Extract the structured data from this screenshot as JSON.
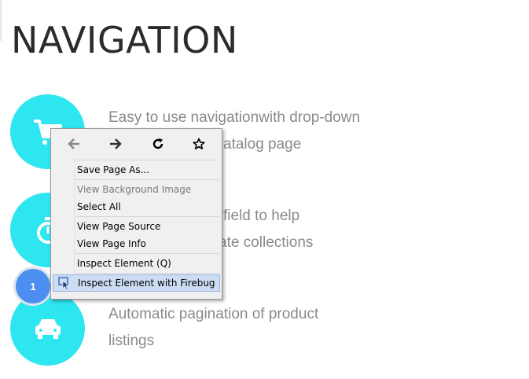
{
  "page": {
    "title": "NAVIGATION"
  },
  "features": [
    {
      "icon": "cart-icon",
      "text": "Easy to use navigationwith drop-down",
      "text2": "atalog page"
    },
    {
      "icon": "stopwatch-icon",
      "text": "field to help",
      "text2": "ate collections"
    },
    {
      "icon": "car-icon",
      "text": "Automatic pagination of product",
      "text2": "listings"
    }
  ],
  "badge": {
    "label": "1"
  },
  "context_menu": {
    "nav": [
      "back-icon",
      "forward-icon",
      "reload-icon",
      "bookmark-star-icon"
    ],
    "items": [
      {
        "label": "Save Page As..."
      },
      {
        "label": "View Background Image",
        "disabled": true
      },
      {
        "label": "Select All"
      },
      {
        "label": "View Page Source"
      },
      {
        "label": "View Page Info"
      },
      {
        "label": "Inspect Element (Q)"
      },
      {
        "label": "Inspect Element with Firebug",
        "highlighted": true
      }
    ]
  },
  "colors": {
    "accent": "#2ee6f0",
    "badge": "#4c8ff0",
    "highlight": "#ccdcf3",
    "text": "#8a8a8a"
  }
}
